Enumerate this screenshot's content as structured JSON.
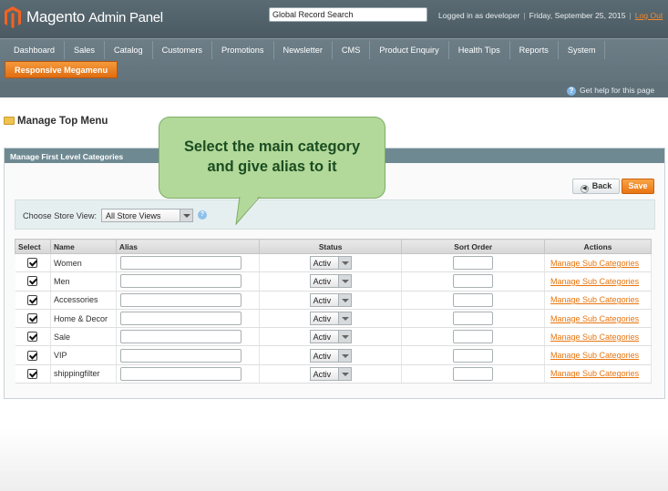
{
  "header": {
    "brand": "Magento",
    "brand_sub": "Admin Panel",
    "search_value": "Global Record Search",
    "logged_in": "Logged in as developer",
    "date": "Friday, September 25, 2015",
    "logout": "Log Out"
  },
  "nav": {
    "items": [
      "Dashboard",
      "Sales",
      "Catalog",
      "Customers",
      "Promotions",
      "Newsletter",
      "CMS",
      "Product Enquiry",
      "Health Tips",
      "Reports",
      "System"
    ],
    "active": "Responsive Megamenu",
    "help": "Get help for this page"
  },
  "page": {
    "title": "Manage Top Menu",
    "section_title": "Manage First Level Categories",
    "back_label": "Back",
    "save_label": "Save",
    "store_label": "Choose Store View:",
    "store_value": "All Store Views"
  },
  "callout": {
    "line1": "Select the main category",
    "line2": "and give alias to it"
  },
  "grid": {
    "headers": [
      "Select",
      "Name",
      "Alias",
      "Status",
      "Sort Order",
      "Actions"
    ],
    "rows": [
      {
        "name": "Women",
        "status": "Activ",
        "action": "Manage Sub Categories"
      },
      {
        "name": "Men",
        "status": "Activ",
        "action": "Manage Sub Categories"
      },
      {
        "name": "Accessories",
        "status": "Activ",
        "action": "Manage Sub Categories"
      },
      {
        "name": "Home & Decor",
        "status": "Activ",
        "action": "Manage Sub Categories"
      },
      {
        "name": "Sale",
        "status": "Activ",
        "action": "Manage Sub Categories"
      },
      {
        "name": "VIP",
        "status": "Activ",
        "action": "Manage Sub Categories"
      },
      {
        "name": "shippingfilter",
        "status": "Activ",
        "action": "Manage Sub Categories"
      }
    ]
  },
  "colors": {
    "accent": "#e8750f",
    "header_bg": "#4b5a62",
    "callout_bg": "#b2d89a"
  }
}
